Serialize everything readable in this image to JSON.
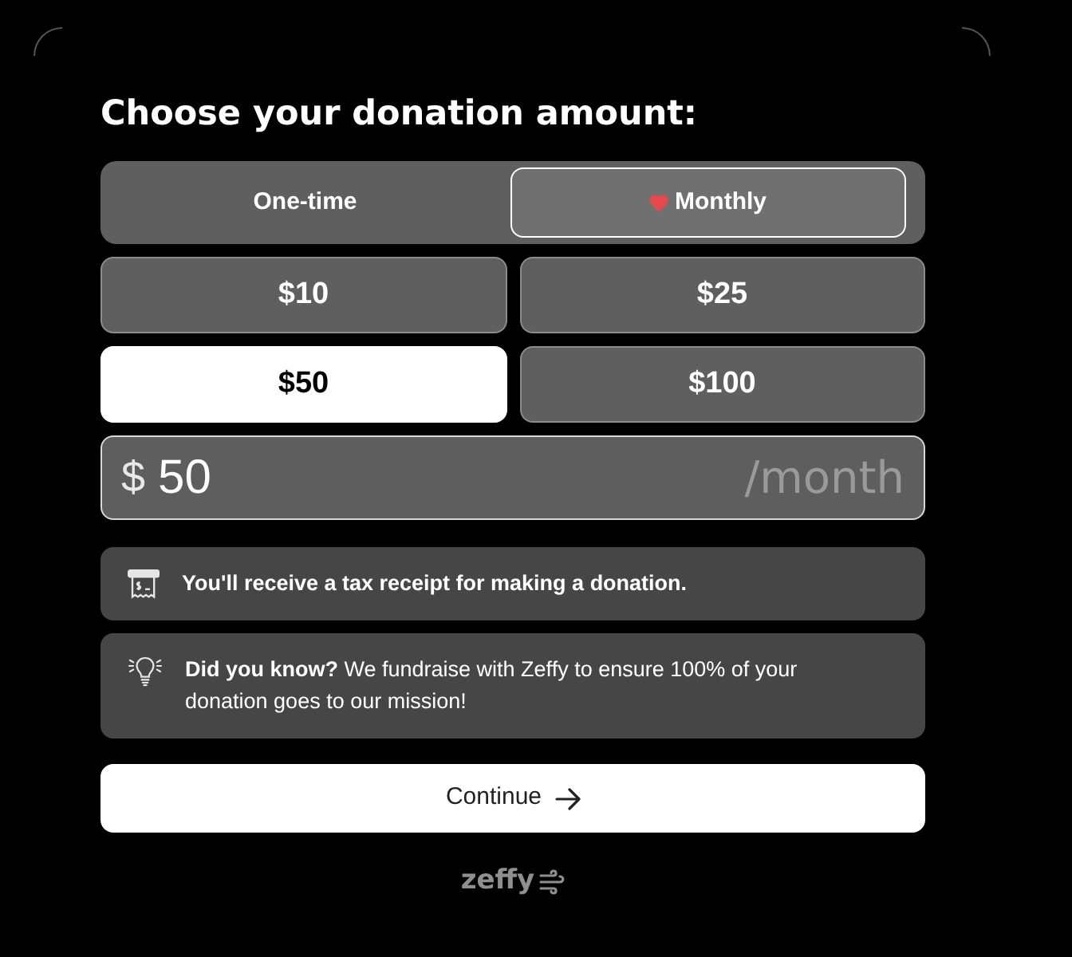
{
  "heading": "Choose your donation amount:",
  "frequency_tabs": [
    {
      "label": "One-time",
      "selected": false
    },
    {
      "label": "Monthly",
      "selected": true
    }
  ],
  "amounts": [
    {
      "label": "$10",
      "selected": false
    },
    {
      "label": "$25",
      "selected": false
    },
    {
      "label": "$50",
      "selected": true
    },
    {
      "label": "$100",
      "selected": false
    }
  ],
  "custom_amount": {
    "currency": "$",
    "value": "50",
    "suffix": "/month"
  },
  "notices": [
    {
      "kind": "receipt",
      "text": "You'll receive a tax receipt for making a donation."
    },
    {
      "kind": "tip",
      "text": "**Did you know?** We fundraise with Zeffy to ensure 100% of your donation goes to our mission!"
    }
  ],
  "continue_button": {
    "label": "Continue"
  },
  "footer": {
    "brand": "zeffy"
  }
}
